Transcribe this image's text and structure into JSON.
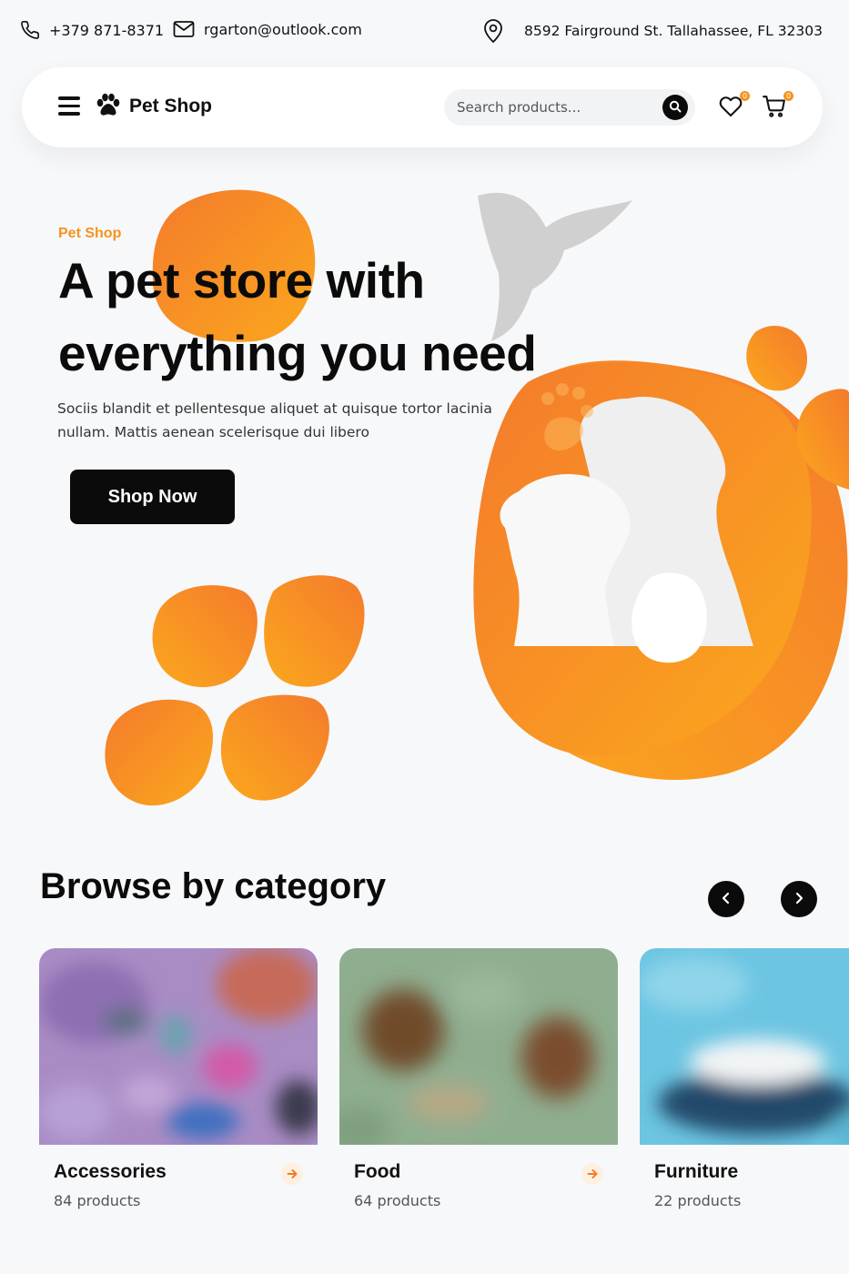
{
  "contact": {
    "phone": "+379 871-8371",
    "email": "rgarton@outlook.com",
    "address": "8592 Fairground St. Tallahassee, FL 32303",
    "icons": [
      "phone-icon",
      "mail-icon",
      "location-pin-icon"
    ]
  },
  "header": {
    "logo_text": "Pet Shop",
    "search_placeholder": "Search products...",
    "wishlist_count": "0",
    "cart_count": "0",
    "icons": [
      "menu-icon",
      "paw-logo-icon",
      "search-icon",
      "heart-icon",
      "cart-icon"
    ]
  },
  "hero": {
    "eyebrow": "Pet Shop",
    "title": "A pet store with everything you need",
    "description": "Sociis blandit et pellentesque aliquet at quisque tortor lacinia nullam. Mattis aenean scelerisque dui libero",
    "cta_label": "Shop Now"
  },
  "categories": {
    "title": "Browse by category",
    "items": [
      {
        "name": "Accessories",
        "count": "84 products"
      },
      {
        "name": "Food",
        "count": "64 products"
      },
      {
        "name": "Furniture",
        "count": "22 products"
      }
    ]
  },
  "colors": {
    "accent": "#f7931e",
    "accent_dark": "#f47b2c",
    "text": "#0b0b0b",
    "background": "#f7f8fa"
  }
}
